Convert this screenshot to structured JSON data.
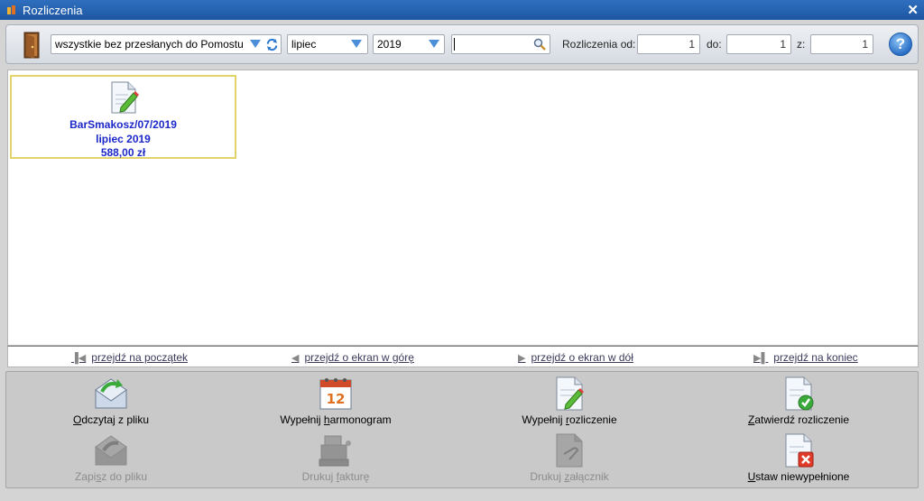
{
  "window": {
    "title": "Rozliczenia"
  },
  "toolbar": {
    "filter_value": "wszystkie bez przesłanych do Pomostu",
    "month_value": "lipiec",
    "year_value": "2019",
    "search_value": "",
    "range_label": "Rozliczenia od:",
    "from_value": "1",
    "to_label": "do:",
    "to_value": "1",
    "of_label": "z:",
    "of_value": "1",
    "help_glyph": "?"
  },
  "items": [
    {
      "line1": "BarSmakosz/07/2019",
      "line2": "lipiec 2019",
      "line3": "588,00 zł"
    }
  ],
  "nav": {
    "first": "przejdź na początek",
    "up": "przejdź o ekran w górę",
    "down": "przejdź o ekran w dół",
    "last": "przejdź na koniec"
  },
  "actions": {
    "read_file": {
      "pre": "",
      "u": "O",
      "post": "dczytaj z pliku"
    },
    "fill_schedule": {
      "pre": "Wypełnij ",
      "u": "h",
      "post": "armonogram"
    },
    "fill_settlement": {
      "pre": "Wypełnij ",
      "u": "r",
      "post": "ozliczenie"
    },
    "approve": {
      "pre": "",
      "u": "Z",
      "post": "atwierdź rozliczenie"
    },
    "save_file": {
      "pre": "Zapi",
      "u": "s",
      "post": "z do pliku"
    },
    "print_invoice": {
      "pre": "Drukuj ",
      "u": "f",
      "post": "akturę"
    },
    "print_attachment": {
      "pre": "Drukuj ",
      "u": "z",
      "post": "ałącznik"
    },
    "set_unfilled": {
      "pre": "",
      "u": "U",
      "post": "staw niewypełnione"
    }
  },
  "colors": {
    "titlebar": "#1d56a3",
    "accent_blue": "#1c28c8",
    "tile_border": "#e2d46a",
    "arrow_blue": "#4a8fd8"
  }
}
